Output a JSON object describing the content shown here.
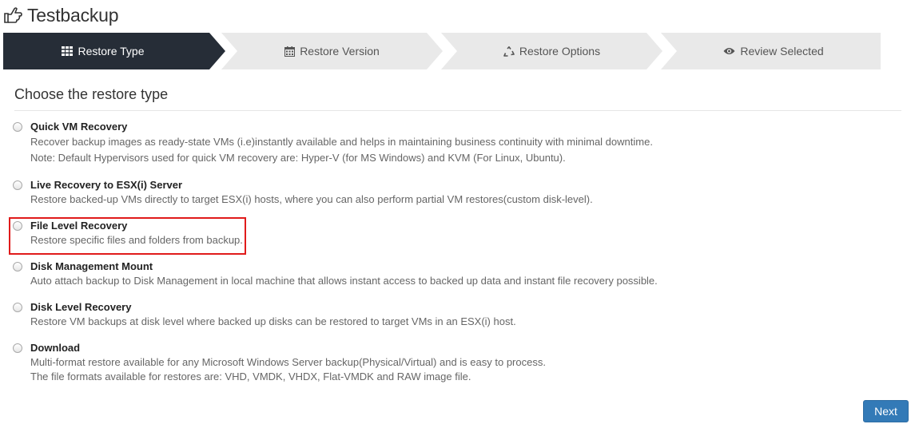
{
  "header": {
    "title": "Testbackup",
    "icon": "hand-pointing-icon"
  },
  "wizard": {
    "active_color": "#262d37",
    "inactive_color": "#e9e9e9",
    "steps": [
      {
        "label": "Restore Type",
        "icon": "grid-icon",
        "active": true
      },
      {
        "label": "Restore Version",
        "icon": "calendar-icon",
        "active": false
      },
      {
        "label": "Restore Options",
        "icon": "recycle-icon",
        "active": false
      },
      {
        "label": "Review Selected",
        "icon": "eye-icon",
        "active": false
      }
    ]
  },
  "main": {
    "heading": "Choose the restore type",
    "selected_option": null,
    "options": [
      {
        "label": "Quick VM Recovery",
        "description": [
          "Recover backup images as ready-state VMs (i.e)instantly available and helps in maintaining business continuity with minimal downtime.",
          "Note: Default Hypervisors used for quick VM recovery are: Hyper-V (for MS Windows) and KVM (For Linux, Ubuntu)."
        ]
      },
      {
        "label": "Live Recovery to ESX(i) Server",
        "description": [
          "Restore backed-up VMs directly to target ESX(i) hosts, where you can also perform partial VM restores(custom disk-level)."
        ]
      },
      {
        "label": "File Level Recovery",
        "description": [
          "Restore specific files and folders from backup."
        ],
        "highlighted": true
      },
      {
        "label": "Disk Management Mount",
        "description": [
          "Auto attach backup to Disk Management in local machine that allows instant access to backed up data and instant file recovery possible."
        ]
      },
      {
        "label": "Disk Level Recovery",
        "description": [
          "Restore VM backups at disk level where backed up disks can be restored to target VMs in an ESX(i) host."
        ]
      },
      {
        "label": "Download",
        "description": [
          "Multi-format restore available for any Microsoft Windows Server backup(Physical/Virtual) and is easy to process.",
          "The file formats available for restores are: VHD, VMDK, VHDX, Flat-VMDK and RAW image file."
        ]
      }
    ]
  },
  "footer": {
    "next_label": "Next",
    "next_color": "#337ab7"
  }
}
